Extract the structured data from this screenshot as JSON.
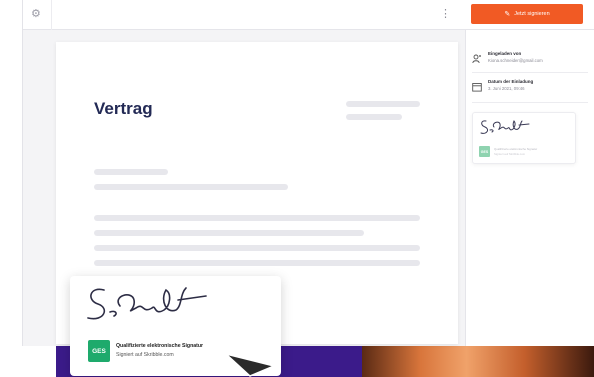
{
  "topbar": {
    "settings_icon": "gear-icon",
    "more_icon": "kebab-menu-icon",
    "more_glyph": "⋮",
    "sign_button_label": "Jetzt signieren",
    "sign_button_icon": "pen-icon",
    "brand_color": "#f15a24"
  },
  "document": {
    "title": "Vertrag",
    "title_color": "#232a55"
  },
  "signature_card": {
    "signature_text": "S. Schmidt",
    "badge": "GES",
    "cert_title": "Qualifizierte elektronische Signatur",
    "cert_subtitle": "Signiert auf Skribble.com",
    "badge_color": "#1eaa6c"
  },
  "sidebar": {
    "meta": [
      {
        "icon": "person-icon",
        "label": "Eingeladen von",
        "value": "Kiona.schneider@gmail.com"
      },
      {
        "icon": "calendar-icon",
        "label": "Datum der Einladung",
        "value": "3. Juni 2021, 09:46"
      }
    ],
    "mini_card": {
      "badge": "GES",
      "line1": "Qualifizierte elektronische Signatur",
      "line2": "Signiert auf Skribble.com"
    }
  },
  "colors": {
    "footer_purple": "#3b1b8a"
  }
}
